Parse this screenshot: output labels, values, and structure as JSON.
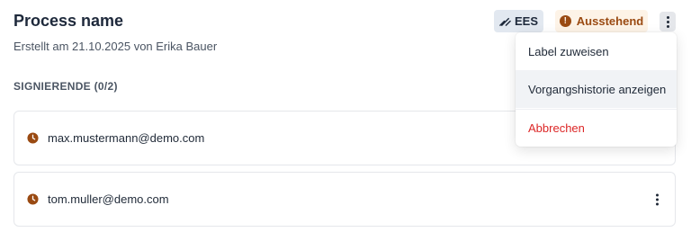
{
  "header": {
    "title": "Process name",
    "subtitle": "Erstellt am 21.10.2025 von Erika Bauer",
    "ees_label": "EES",
    "status_label": "Ausstehend",
    "status_icon_glyph": "!"
  },
  "signers": {
    "section_label": "SIGNIERENDE (0/2)",
    "items": [
      {
        "email": "max.mustermann@demo.com",
        "status_icon": "clock-icon"
      },
      {
        "email": "tom.muller@demo.com",
        "status_icon": "clock-icon"
      }
    ]
  },
  "menu": {
    "items": [
      {
        "label": "Label zuweisen"
      },
      {
        "label": "Vorgangshistorie anzeigen"
      },
      {
        "label": "Abbrechen"
      }
    ]
  },
  "colors": {
    "status_text": "#9a4a12",
    "status_bg": "#fdf3e7",
    "danger": "#dc2626",
    "clock": "#9a4a12"
  }
}
